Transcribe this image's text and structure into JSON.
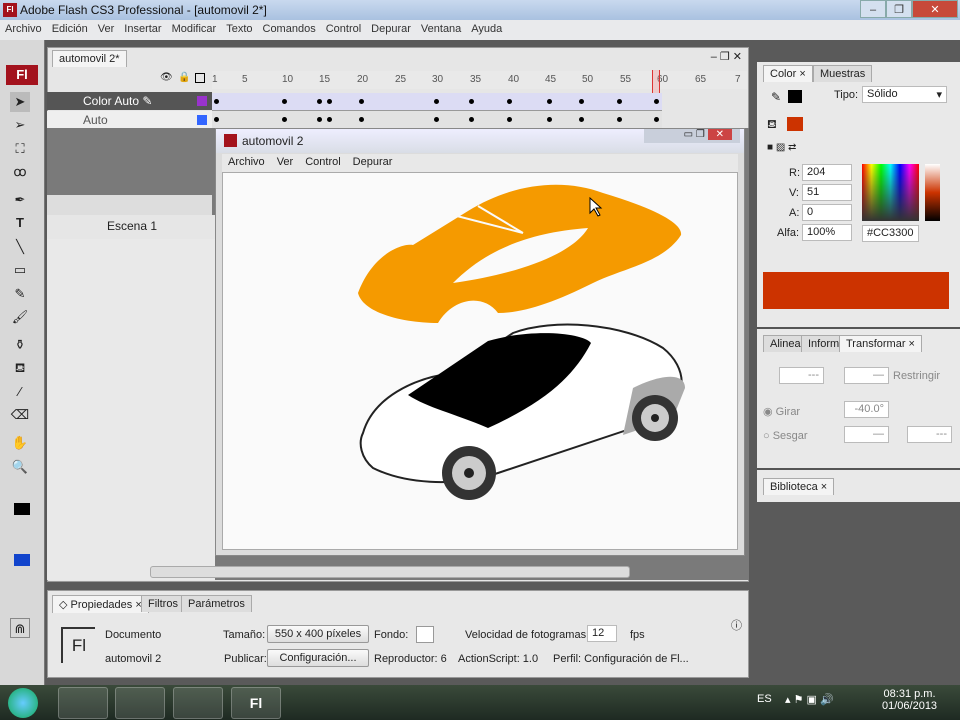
{
  "app": {
    "title": "Adobe Flash CS3 Professional - [automovil 2*]",
    "logo": "Fl"
  },
  "menu": [
    "Archivo",
    "Edición",
    "Ver",
    "Insertar",
    "Modificar",
    "Texto",
    "Comandos",
    "Control",
    "Depurar",
    "Ventana",
    "Ayuda"
  ],
  "timeline": {
    "doc_tab": "automovil 2*",
    "ruler": [
      "1",
      "5",
      "10",
      "15",
      "20",
      "25",
      "30",
      "35",
      "40",
      "45",
      "50",
      "55",
      "60",
      "65",
      "7"
    ],
    "current_frame": 60,
    "layers": [
      {
        "name": "Color Auto",
        "color": "#9933cc",
        "active": true
      },
      {
        "name": "Auto",
        "color": "#3366ff",
        "active": false
      }
    ],
    "scene": "Escena 1"
  },
  "docwindow": {
    "title": "automovil 2",
    "menu": [
      "Archivo",
      "Ver",
      "Control",
      "Depurar"
    ]
  },
  "color_panel": {
    "tabs": [
      "Color",
      "Muestras"
    ],
    "tipo_label": "Tipo:",
    "tipo_value": "Sólido",
    "r_label": "R:",
    "r": "204",
    "v_label": "V:",
    "v": "51",
    "a_label": "A:",
    "a": "0",
    "alfa_label": "Alfa:",
    "alfa": "100%",
    "hex": "#CC3300",
    "fill": "#cc3300"
  },
  "transform_panel": {
    "tabs": [
      "Alinear",
      "Inform",
      "Transformar"
    ],
    "w": "---",
    "h": "—",
    "restringir": "Restringir",
    "girar": "Girar",
    "girar_value": "-40.0°",
    "sesgar": "Sesgar",
    "sx": "—",
    "sy": "---"
  },
  "library": {
    "tab": "Biblioteca"
  },
  "properties": {
    "tabs": [
      "Propiedades",
      "Filtros",
      "Parámetros"
    ],
    "doc_label": "Documento",
    "doc_name": "automovil 2",
    "size_label": "Tamaño:",
    "size": "550 x 400 píxeles",
    "fondo_label": "Fondo:",
    "fps_label": "Velocidad de fotogramas:",
    "fps": "12",
    "fps_unit": "fps",
    "publish_label": "Publicar:",
    "publish_btn": "Configuración...",
    "player": "Reproductor: 6",
    "actionscript": "ActionScript: 1.0",
    "profile": "Perfil: Configuración de Fl..."
  },
  "taskbar": {
    "lang": "ES",
    "time": "08:31 p.m.",
    "date": "01/06/2013"
  }
}
